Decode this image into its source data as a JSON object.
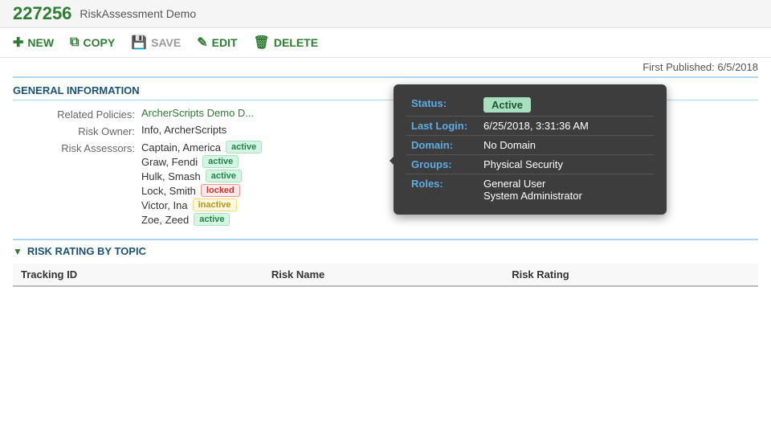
{
  "header": {
    "id": "227256",
    "title": "RiskAssessment Demo"
  },
  "toolbar": {
    "new_label": "NEW",
    "copy_label": "COPY",
    "save_label": "SAVE",
    "edit_label": "EDIT",
    "delete_label": "DELETE"
  },
  "first_published": "First Published: 6/5/2018",
  "general_info": {
    "section_label": "GENERAL INFORMATION",
    "related_policies_label": "Related Policies:",
    "related_policies_value": "ArcherScripts Demo D...",
    "risk_owner_label": "Risk Owner:",
    "risk_owner_value": "Info, ArcherScripts",
    "risk_assessors_label": "Risk Assessors:",
    "assessors": [
      {
        "name": "Captain, America",
        "status": "active",
        "badge_type": "active"
      },
      {
        "name": "Graw, Fendi",
        "status": "active",
        "badge_type": "active"
      },
      {
        "name": "Hulk, Smash",
        "status": "active",
        "badge_type": "active"
      },
      {
        "name": "Lock, Smith",
        "status": "locked",
        "badge_type": "locked"
      },
      {
        "name": "Victor, Ina",
        "status": "inactive",
        "badge_type": "inactive"
      },
      {
        "name": "Zoe, Zeed",
        "status": "active",
        "badge_type": "active"
      }
    ]
  },
  "tooltip": {
    "status_label": "Status:",
    "status_value": "Active",
    "last_login_label": "Last Login:",
    "last_login_value": "6/25/2018, 3:31:36 AM",
    "domain_label": "Domain:",
    "domain_value": "No Domain",
    "groups_label": "Groups:",
    "groups_value": "Physical Security",
    "roles_label": "Roles:",
    "roles_value1": "General User",
    "roles_value2": "System Administrator"
  },
  "risk_rating": {
    "section_label": "RISK RATING BY TOPIC",
    "columns": [
      "Tracking ID",
      "Risk Name",
      "Risk Rating"
    ]
  }
}
